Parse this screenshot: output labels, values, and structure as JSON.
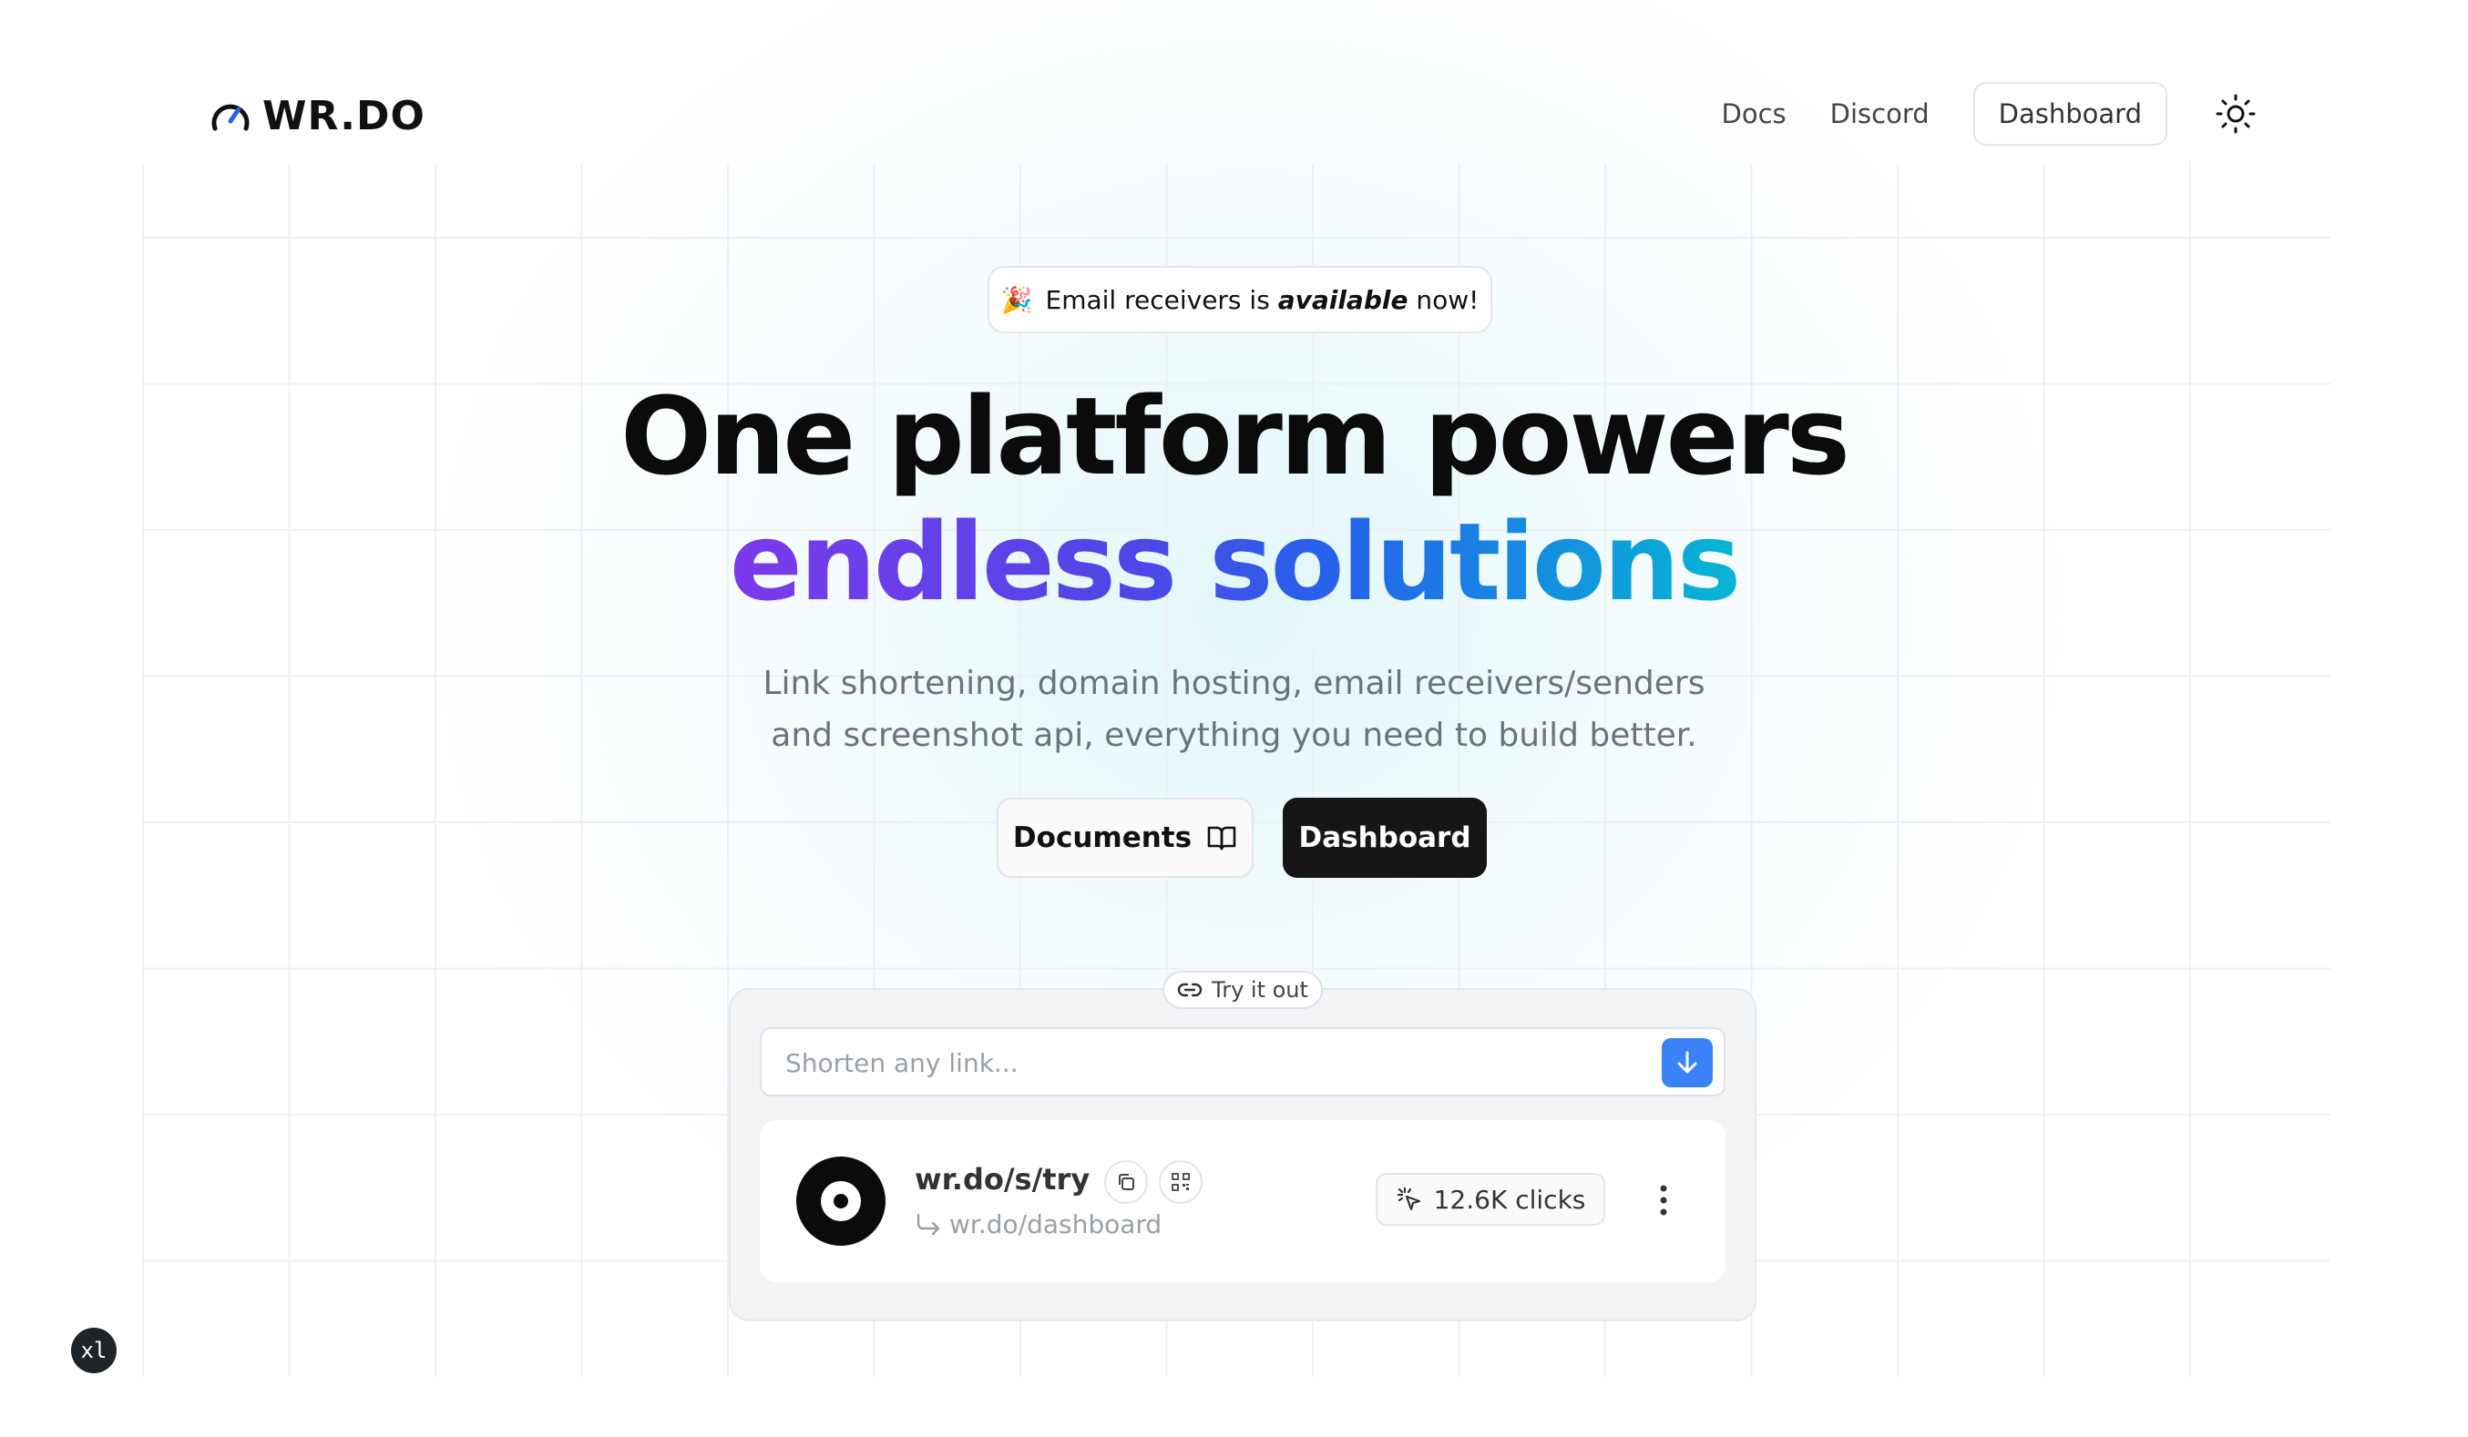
{
  "brand": {
    "name": "WR.DO"
  },
  "nav": {
    "docs": "Docs",
    "discord": "Discord",
    "dashboard": "Dashboard"
  },
  "announcement": {
    "emoji": "🎉",
    "text_before": "Email receivers is ",
    "text_bold": "available",
    "text_after": " now!"
  },
  "hero": {
    "line1": "One platform powers",
    "line2": "endless solutions",
    "subtitle_line1": "Link shortening, domain hosting, email receivers/senders",
    "subtitle_line2": "and screenshot api, everything you need to build better."
  },
  "cta": {
    "documents": "Documents",
    "dashboard": "Dashboard"
  },
  "demo": {
    "badge": "Try it out",
    "input_placeholder": "Shorten any link...",
    "link": {
      "short_url": "wr.do/s/try",
      "target_url": "wr.do/dashboard",
      "clicks": "12.6K clicks"
    }
  },
  "devtools_badge": "xl",
  "colors": {
    "accent_blue": "#3b82f6",
    "dark_button": "#161616",
    "gradient_start": "#7c3aed",
    "gradient_end": "#06b6d4"
  }
}
